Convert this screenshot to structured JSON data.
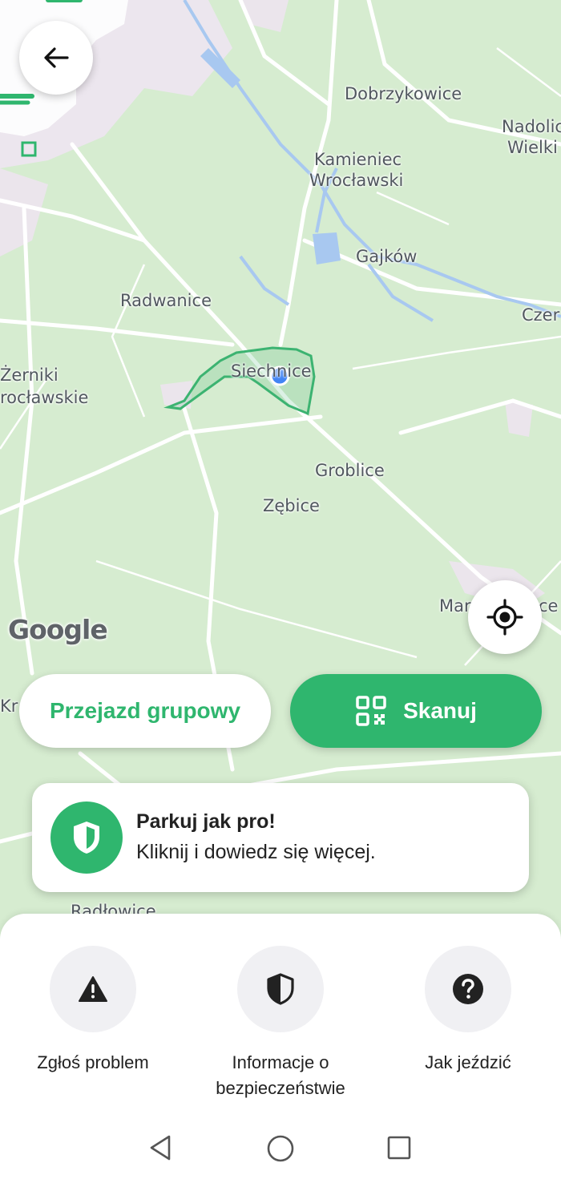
{
  "map": {
    "places": [
      "Dobrzykowice",
      "Nadolic",
      "Wielki",
      "Kamieniec",
      "Wrocławski",
      "Gajków",
      "Czer",
      "Radwanice",
      "Żerniki",
      "rocławskie",
      "Siechnice",
      "Groblice",
      "Zębice",
      "Mar",
      "ce",
      "Kr",
      "Radłowice"
    ],
    "attribution": "Google",
    "zone_color": "#3cb371",
    "location_dot_color": "#4285f4"
  },
  "header": {
    "back_icon": "arrow-left-icon"
  },
  "buttons": {
    "group_ride_label": "Przejazd grupowy",
    "scan_label": "Skanuj",
    "scan_icon": "qr-code-icon",
    "locate_icon": "crosshair-icon",
    "accent": "#2fb66e"
  },
  "promo": {
    "title": "Parkuj jak pro!",
    "subtitle": "Kliknij i dowiedz się więcej.",
    "icon": "shield-icon"
  },
  "sheet": {
    "actions": [
      {
        "label": "Zgłoś problem",
        "icon": "warning-icon"
      },
      {
        "label": "Informacje o bezpieczeństwie",
        "icon": "shield-icon"
      },
      {
        "label": "Jak jeździć",
        "icon": "question-icon"
      }
    ]
  },
  "navbar": {
    "icons": [
      "back-triangle-icon",
      "home-circle-icon",
      "recents-square-icon"
    ]
  }
}
